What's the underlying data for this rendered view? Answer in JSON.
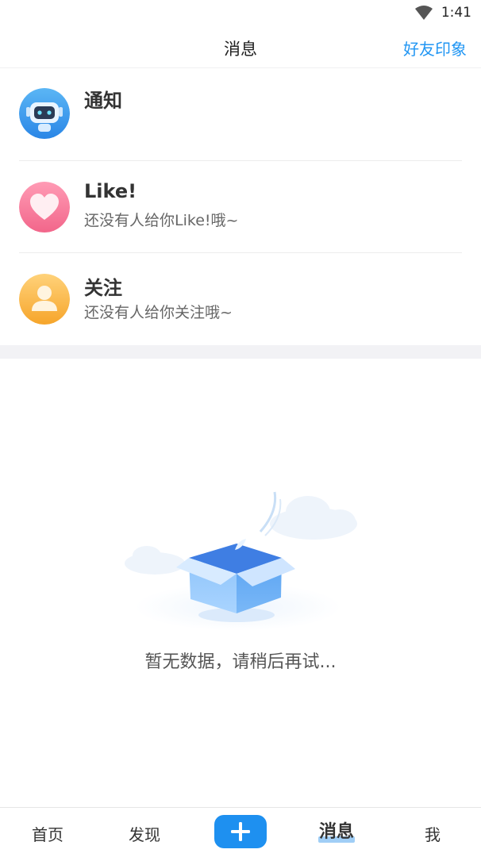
{
  "status_bar": {
    "time": "1:41",
    "wifi_icon": "wifi-icon"
  },
  "header": {
    "title": "消息",
    "action_label": "好友印象"
  },
  "messages": [
    {
      "title": "通知",
      "subtitle": "",
      "icon": "robot-avatar-icon"
    },
    {
      "title": "Like!",
      "subtitle": "还没有人给你Like!哦~",
      "icon": "heart-avatar-icon"
    },
    {
      "title": "关注",
      "subtitle": "还没有人给你关注哦~",
      "icon": "person-avatar-icon"
    }
  ],
  "empty_state": {
    "text": "暂无数据，请稍后再试...",
    "icon": "empty-box-icon"
  },
  "bottom_nav": {
    "items": [
      {
        "label": "首页"
      },
      {
        "label": "发现"
      },
      {
        "label": "消息"
      },
      {
        "label": "我"
      }
    ],
    "add_icon": "plus-icon",
    "active": "消息"
  },
  "colors": {
    "accent": "#1e90f0",
    "link": "#2196f3"
  }
}
